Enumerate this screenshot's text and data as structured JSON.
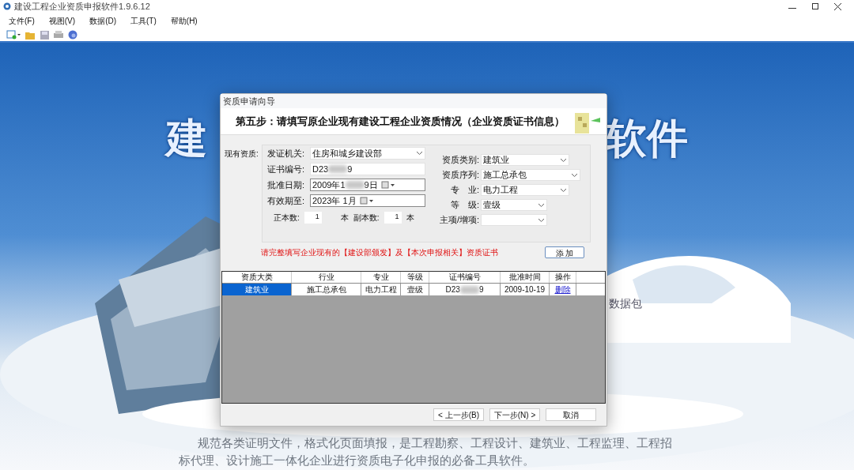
{
  "window": {
    "title": "建设工程企业资质申报软件1.9.6.12"
  },
  "menu": [
    "文件(F)",
    "视图(V)",
    "数据(D)",
    "工具(T)",
    "帮助(H)"
  ],
  "background": {
    "left_title": "建",
    "right_title": "软件",
    "side_text": "数据包",
    "paragraph": "规范各类证明文件，格式化页面填报，是工程勘察、工程设计、建筑业、工程监理、工程招",
    "paragraph_line2": "标代理、设计施工一体化企业进行资质电子化申报的必备工具软件。"
  },
  "dialog": {
    "title": "资质申请向导",
    "heading": "第五步：请填写原企业现有建设工程企业资质情况（企业资质证书信息）",
    "group_label": "现有资质:",
    "left_fields": [
      {
        "kind": "select",
        "label": "发证机关:",
        "value": [
          "住房和城乡建设部"
        ]
      },
      {
        "kind": "text",
        "label": "证书编号:",
        "value": [
          "D23",
          "9"
        ]
      },
      {
        "kind": "date",
        "label": "批准日期:",
        "value": [
          "2009年1",
          "9日"
        ]
      },
      {
        "kind": "date",
        "label": "有效期至:",
        "value": [
          "2023年 1月"
        ]
      }
    ],
    "right_fields": [
      {
        "label": "资质类别:",
        "value": "建筑业"
      },
      {
        "label": "资质序列:",
        "value": "施工总承包"
      },
      {
        "label": "专　业:",
        "value": "电力工程"
      },
      {
        "label": "等　级:",
        "value": "壹级"
      },
      {
        "label": "主项/增项:"
      }
    ],
    "copies": {
      "original_label": "正本数:",
      "original_value": "1",
      "unit1": "本",
      "duplicate_label": "副本数:",
      "duplicate_value": "1",
      "unit2": "本"
    },
    "notice": "请完整填写企业现有的【建设部颁发】及【本次申报相关】资质证书",
    "add_button": "添 加",
    "table": {
      "columns": [
        "资质大类",
        "行业",
        "专业",
        "等级",
        "证书编号",
        "批准时间",
        "操作"
      ],
      "rows": [
        {
          "selected": true,
          "cells": [
            "建筑业",
            "施工总承包",
            "电力工程",
            "壹级",
            [
              "D23",
              "9"
            ],
            "2009-10-19"
          ],
          "action": "删除"
        }
      ]
    },
    "buttons": [
      "< 上一步(B)",
      "下一步(N) >",
      "取消"
    ]
  }
}
